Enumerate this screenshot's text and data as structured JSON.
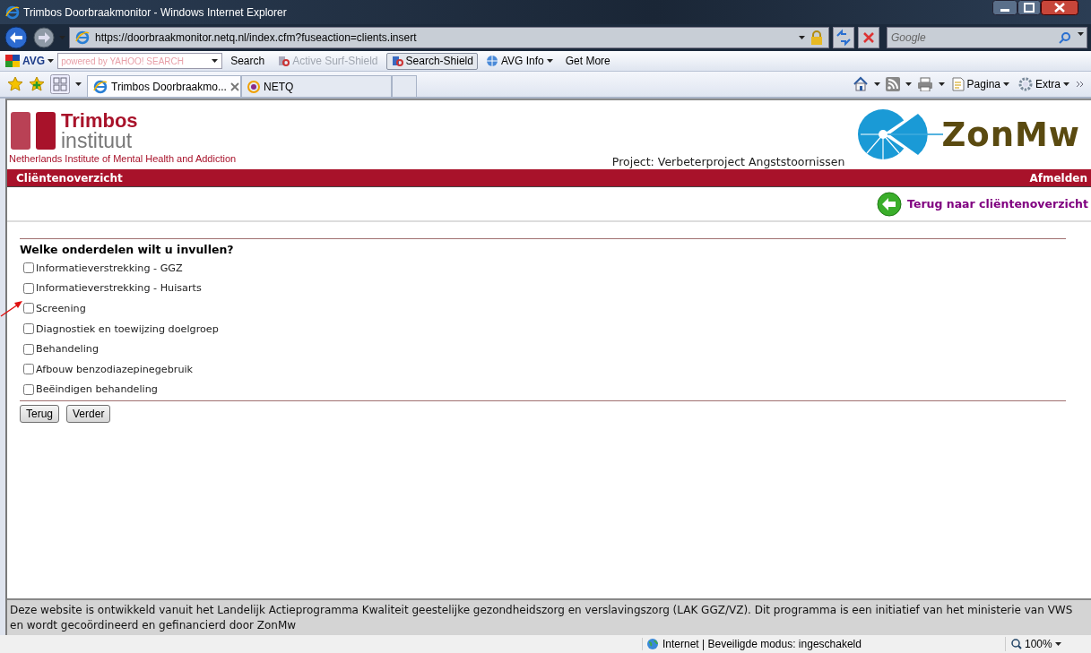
{
  "window": {
    "title": "Trimbos Doorbraakmonitor - Windows Internet Explorer"
  },
  "address_bar": {
    "url": "https://doorbraakmonitor.netq.nl/index.cfm?fuseaction=clients.insert",
    "search_placeholder": "Google"
  },
  "avg_toolbar": {
    "logo": "AVG",
    "search_placeholder": "powered by YAHOO! SEARCH",
    "items": [
      {
        "label": "Search",
        "kind": "button",
        "disabled": false,
        "on": false
      },
      {
        "label": "Active Surf-Shield",
        "kind": "shield",
        "disabled": true,
        "on": false
      },
      {
        "label": "Search-Shield",
        "kind": "shield",
        "disabled": false,
        "on": true
      },
      {
        "label": "AVG Info",
        "kind": "menu",
        "disabled": false,
        "on": false
      },
      {
        "label": "Get More",
        "kind": "button",
        "disabled": false,
        "on": false
      }
    ]
  },
  "tabs": [
    {
      "label": "Trimbos Doorbraakmo...",
      "selected": true
    },
    {
      "label": "NETQ",
      "selected": false
    }
  ],
  "command_bar": {
    "items": [
      {
        "label": "Pagina"
      },
      {
        "label": "Extra"
      }
    ]
  },
  "page": {
    "header": {
      "logo_title": "Trimbos",
      "logo_subtitle": "instituut",
      "tagline": "Netherlands Institute of Mental Health and Addiction",
      "project": "Project: Verbeterproject Angststoornissen",
      "partner_logo": "ZonMw"
    },
    "nav_bar": {
      "title": "Cliëntenoverzicht",
      "logout": "Afmelden"
    },
    "back_link": "Terug naar cliëntenoverzicht",
    "form": {
      "question": "Welke onderdelen wilt u invullen?",
      "options": [
        {
          "label": "Informatieverstrekking - GGZ",
          "checked": false
        },
        {
          "label": "Informatieverstrekking - Huisarts",
          "checked": false
        },
        {
          "label": "Screening",
          "checked": false
        },
        {
          "label": "Diagnostiek en toewijzing doelgroep",
          "checked": false
        },
        {
          "label": "Behandeling",
          "checked": false
        },
        {
          "label": "Afbouw benzodiazepinegebruik",
          "checked": false
        },
        {
          "label": "Beëindigen behandeling",
          "checked": false
        }
      ],
      "buttons": [
        "Terug",
        "Verder"
      ]
    },
    "footer": "Deze website is ontwikkeld vanuit het Landelijk Actieprogramma Kwaliteit geestelijke gezondheidszorg en verslavingszorg (LAK GGZ/VZ). Dit programma is een initiatief van het ministerie van VWS en wordt gecoördineerd en gefinancierd door ZonMw"
  },
  "status_bar": {
    "zone": "Internet | Beveiligde modus: ingeschakeld",
    "zoom": "100%"
  }
}
